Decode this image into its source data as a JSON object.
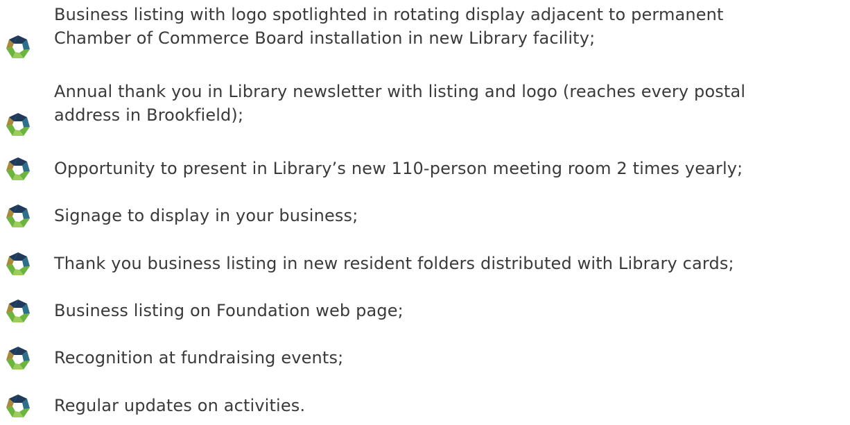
{
  "bullet_icon": {
    "name": "aperture-icon",
    "colors": {
      "navy": "#1f3a5a",
      "gold": "#a88a3e",
      "green": "#6db33f",
      "lightgreen": "#9ccd5a",
      "teal": "#2f6f8a"
    }
  },
  "benefits": {
    "items": [
      {
        "lines": [
          "Business listing with logo spotlighted in rotating display adjacent to permanent",
          "Chamber of Commerce Board installation in new Library facility;"
        ]
      },
      {
        "lines": [
          "Annual thank you in Library newsletter with listing and logo (reaches every postal",
          "address in Brookfield);"
        ]
      },
      {
        "lines": [
          "Opportunity to present in Library’s new 110-person meeting room 2 times yearly;"
        ]
      },
      {
        "lines": [
          "Signage to display in your business;"
        ]
      },
      {
        "lines": [
          "Thank you business listing in new resident folders distributed with Library cards;"
        ]
      },
      {
        "lines": [
          "Business listing on Foundation web page;"
        ]
      },
      {
        "lines": [
          "Recognition at fundraising events;"
        ]
      },
      {
        "lines": [
          "Regular updates on activities."
        ]
      }
    ]
  }
}
